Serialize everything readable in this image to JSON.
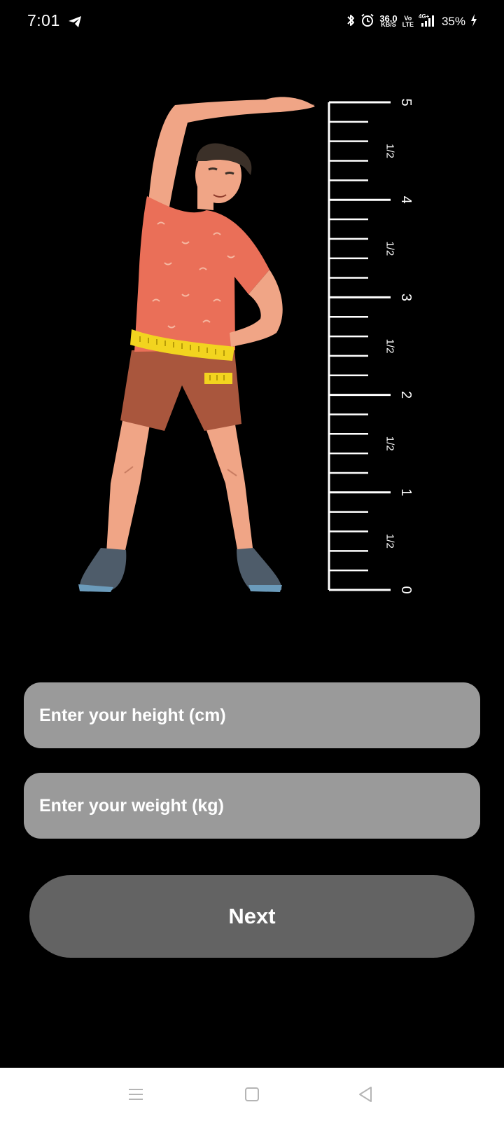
{
  "status_bar": {
    "time": "7:01",
    "net_speed_value": "36.0",
    "net_speed_unit": "KB/S",
    "volte_top": "Vo",
    "volte_bottom": "LTE",
    "network": "4G+",
    "battery_percent": "35%",
    "icons": [
      "telegram-icon",
      "bluetooth-icon",
      "alarm-icon",
      "signal-icon",
      "charging-icon"
    ]
  },
  "illustration": {
    "description_icon": "man-stretching-with-tape-measure-and-ruler",
    "ruler_labels": [
      "5",
      "1/2",
      "4",
      "1/2",
      "3",
      "1/2",
      "2",
      "1/2",
      "1",
      "1/2",
      "0"
    ]
  },
  "form": {
    "height_placeholder": "Enter your height (cm)",
    "weight_placeholder": "Enter your weight (kg)",
    "height_value": "",
    "weight_value": "",
    "next_label": "Next"
  },
  "nav_bar": {
    "icons": [
      "menu-icon",
      "home-icon",
      "back-icon"
    ]
  },
  "colors": {
    "background": "#000000",
    "input_background": "#9a9a9a",
    "button_background": "#636363",
    "nav_background": "#ffffff",
    "nav_icon": "#b5b5b5"
  }
}
